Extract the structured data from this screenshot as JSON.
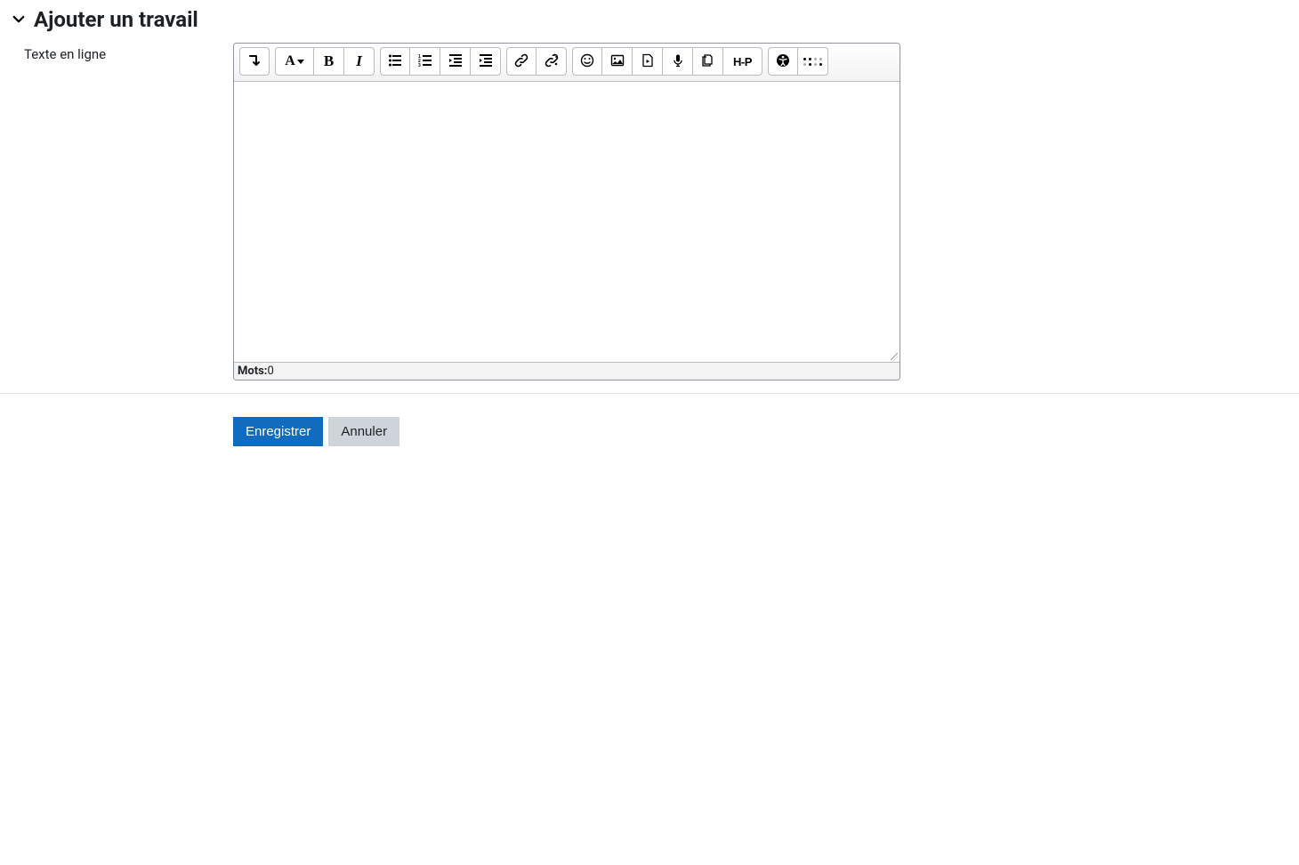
{
  "section": {
    "title": "Ajouter un travail"
  },
  "form": {
    "onlinetext_label": "Texte en ligne"
  },
  "editor": {
    "words_label": "Mots:",
    "words_count": "0",
    "content": ""
  },
  "toolbar": {
    "toggle_tooltip": "Afficher plus de boutons",
    "styles_tooltip": "Styles",
    "bold_tooltip": "Gras",
    "italic_tooltip": "Italique",
    "ul_tooltip": "Liste non ordonnée",
    "ol_tooltip": "Liste ordonnée",
    "outdent_tooltip": "Diminuer le retrait",
    "indent_tooltip": "Augmenter le retrait",
    "link_tooltip": "Lien",
    "unlink_tooltip": "Supprimer le lien",
    "emoji_tooltip": "Émoticône",
    "image_tooltip": "Insérer une image",
    "media_tooltip": "Insérer un fichier média",
    "record_audio_tooltip": "Enregistrer un son",
    "manage_files_tooltip": "Gérer les fichiers",
    "h5p_tooltip": "Insérer H5P",
    "a11y_tooltip": "Vérificateur d'accessibilité",
    "screenreader_tooltip": "Aide lecteur d'écran"
  },
  "actions": {
    "save": "Enregistrer",
    "cancel": "Annuler"
  }
}
